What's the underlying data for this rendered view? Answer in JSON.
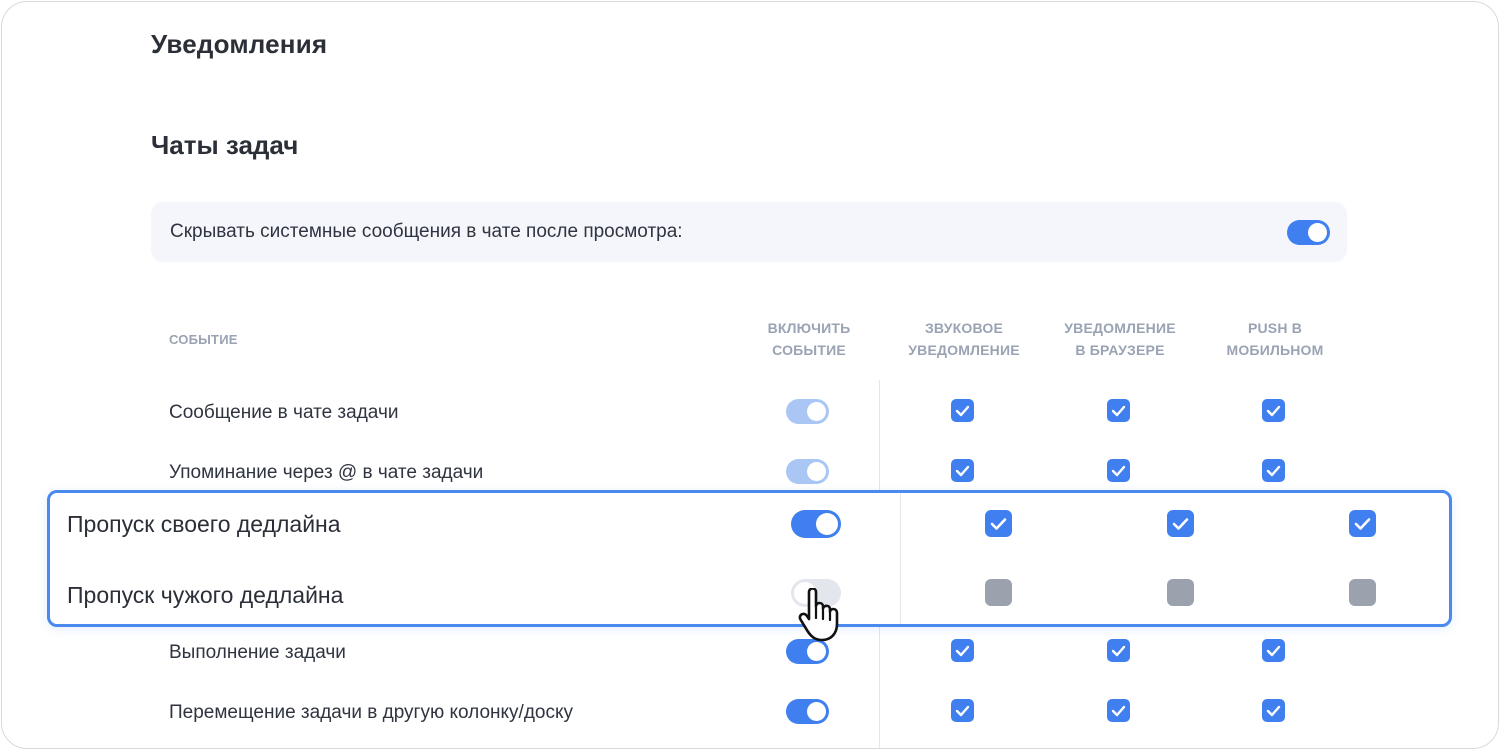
{
  "page_title": "Уведомления",
  "section_title": "Чаты задач",
  "hide_system_setting": {
    "label": "Скрывать системные сообщения в чате после просмотра:",
    "enabled": true
  },
  "columns": {
    "event": "СОБЫТИЕ",
    "enable": [
      "ВКЛЮЧИТЬ",
      "СОБЫТИЕ"
    ],
    "sound": [
      "ЗВУКОВОЕ",
      "УВЕДОМЛЕНИЕ"
    ],
    "browser": [
      "УВЕДОМЛЕНИЕ",
      "В БРАУЗЕРЕ"
    ],
    "push": [
      "PUSH В",
      "МОБИЛЬНОМ"
    ]
  },
  "rows": [
    {
      "label": "Сообщение в чате задачи",
      "toggle": "dim",
      "sound": true,
      "browser": true,
      "push": true
    },
    {
      "label": "Упоминание через @ в чате задачи",
      "toggle": "dim",
      "sound": true,
      "browser": true,
      "push": true
    },
    {
      "label": "Пропуск своего дедлайна",
      "toggle": "on",
      "sound": true,
      "browser": true,
      "push": true
    },
    {
      "label": "Пропуск чужого дедлайна",
      "toggle": "off",
      "sound": false,
      "browser": false,
      "push": false
    },
    {
      "label": "Выполнение задачи",
      "toggle": "on",
      "sound": true,
      "browser": true,
      "push": true
    },
    {
      "label": "Перемещение задачи в другую колонку/доску",
      "toggle": "on",
      "sound": true,
      "browser": true,
      "push": true
    }
  ],
  "colors": {
    "accent": "#3f7ff0",
    "toggle_dim": "#a9c6f5",
    "toggle_off": "#e3e6ec",
    "checkbox_off": "#9ca2ad",
    "highlight_border": "#4a89ee"
  },
  "icons": {
    "check": "check-icon",
    "cursor": "hand-pointer-icon"
  }
}
